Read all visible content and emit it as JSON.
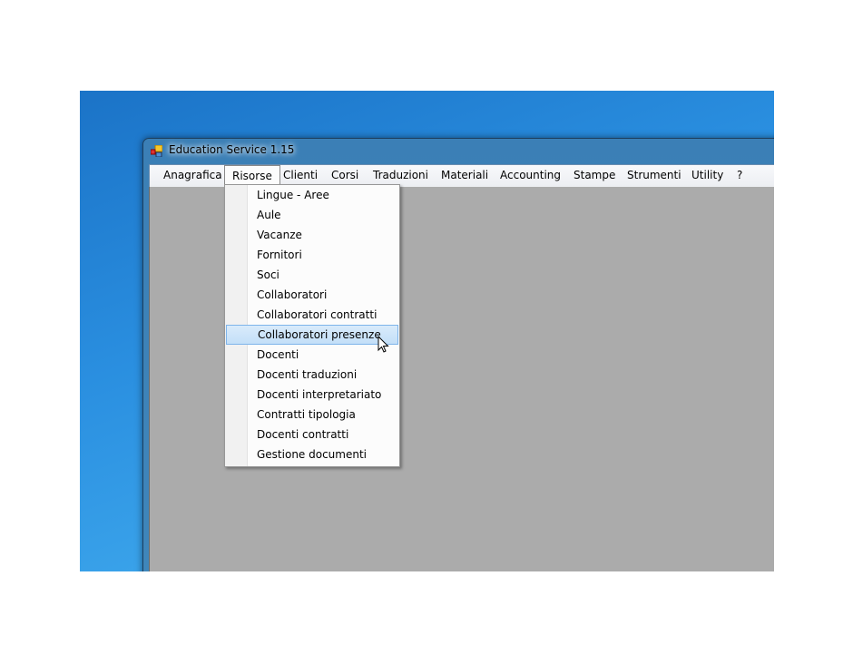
{
  "window": {
    "title": "Education Service 1.15"
  },
  "menubar": {
    "items": [
      {
        "label": "Anagrafica",
        "open": false
      },
      {
        "label": "Risorse",
        "open": true
      },
      {
        "label": "Clienti",
        "open": false
      },
      {
        "label": "Corsi",
        "open": false
      },
      {
        "label": "Traduzioni",
        "open": false
      },
      {
        "label": "Materiali",
        "open": false
      },
      {
        "label": "Accounting",
        "open": false
      },
      {
        "label": "Stampe",
        "open": false
      },
      {
        "label": "Strumenti",
        "open": false
      },
      {
        "label": "Utility",
        "open": false
      },
      {
        "label": "?",
        "open": false
      }
    ]
  },
  "risorse_menu": {
    "highlighted": "Collaboratori presenze",
    "items": [
      "Lingue - Aree",
      "Aule",
      "Vacanze",
      "Fornitori",
      "Soci",
      "Collaboratori",
      "Collaboratori contratti",
      "Collaboratori presenze",
      "Docenti",
      "Docenti traduzioni",
      "Docenti interpretariato",
      "Contratti tipologia",
      "Docenti contratti",
      "Gestione documenti"
    ]
  },
  "colors": {
    "client_area": "#ababab",
    "highlight": "#c3dff8",
    "title_bar": "#3f86bb"
  }
}
